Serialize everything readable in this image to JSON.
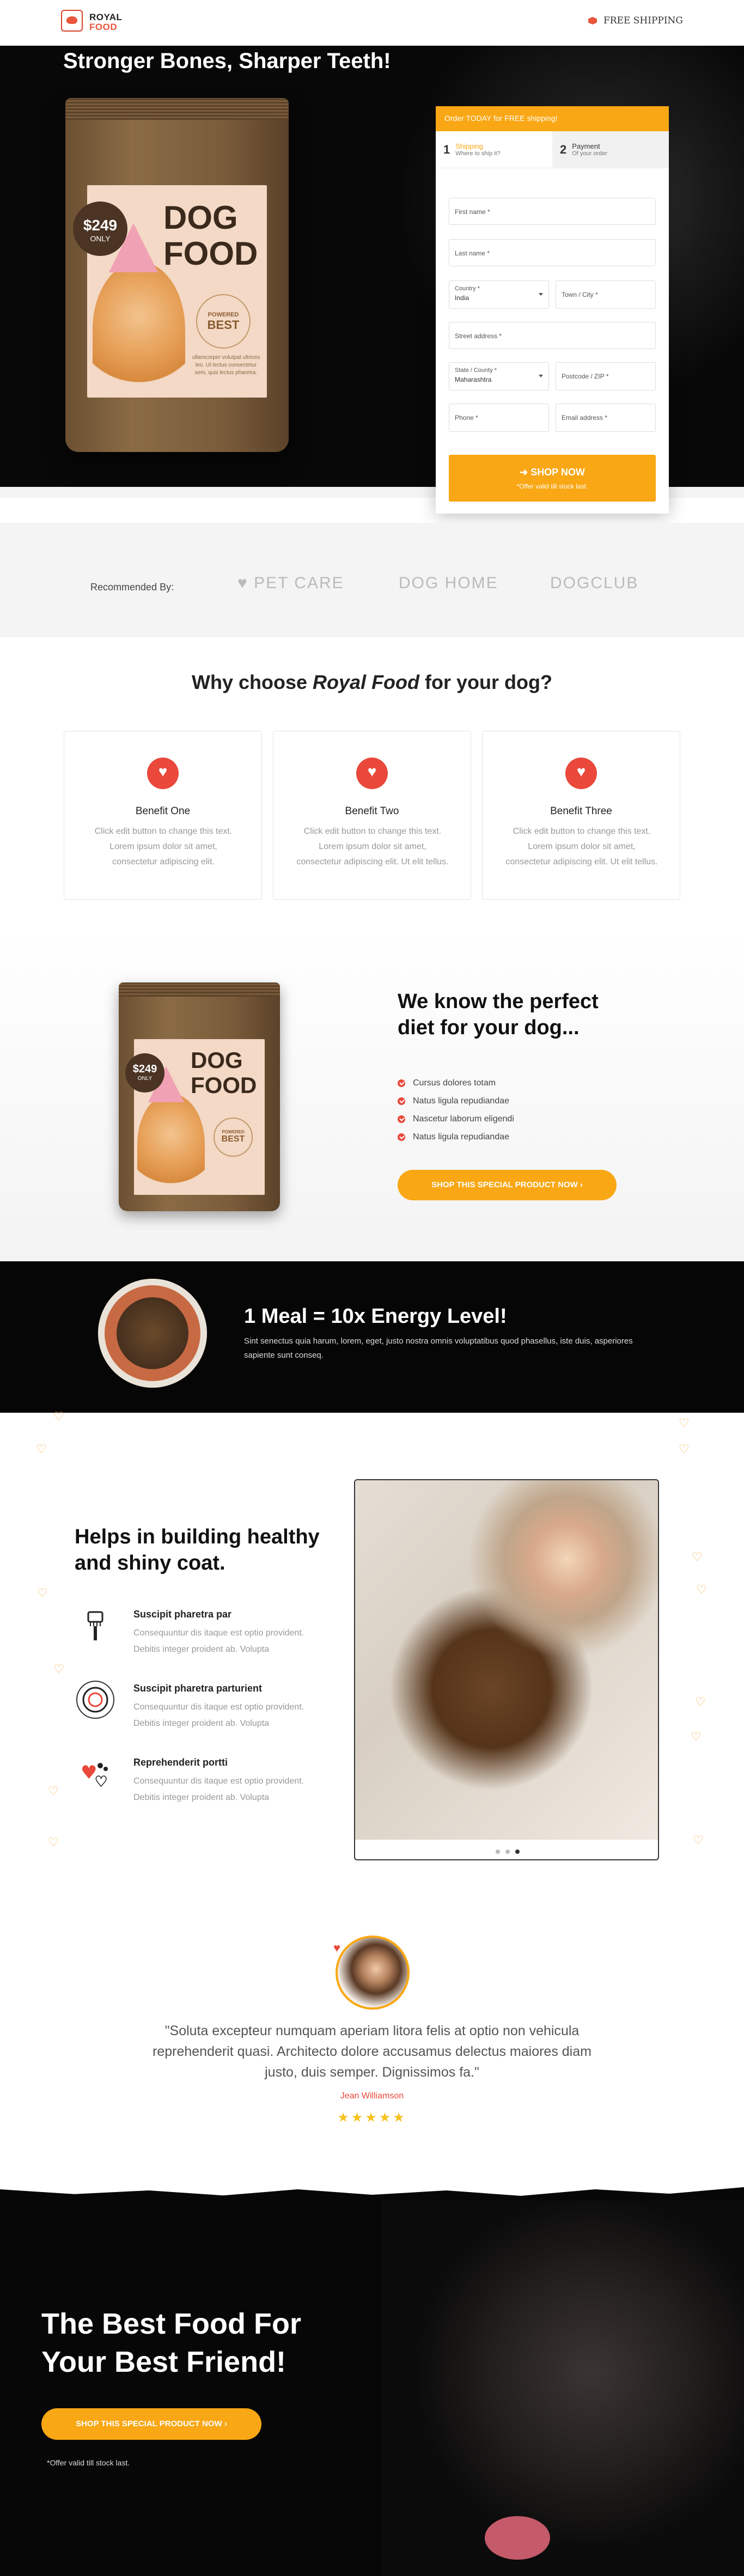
{
  "header": {
    "logo_line1": "ROYAL",
    "logo_line2": "FOOD",
    "shipping_label": "FREE SHIPPING"
  },
  "hero": {
    "title": "Stronger Bones, Sharper Teeth!",
    "product": {
      "brand_word1": "DOG",
      "brand_word2": "FOOD",
      "price": "$249",
      "price_note": "ONLY",
      "seal_line1": "POWERED",
      "seal_line2": "BEST",
      "blurb": "ullamcorper volutpat ultrices leo. Ut lectus consectetur sem, quis lectus pharetra."
    }
  },
  "form": {
    "banner": "Order TODAY for FREE shipping!",
    "steps": [
      {
        "num": "1",
        "title": "Shipping",
        "sub": "Where to ship it?"
      },
      {
        "num": "2",
        "title": "Payment",
        "sub": "Of your order"
      }
    ],
    "fields": {
      "first_name": "First name *",
      "last_name": "Last name *",
      "country_label": "Country *",
      "country_value": "India",
      "town": "Town / City *",
      "street": "Street address *",
      "state_label": "State / County *",
      "state_value": "Maharashtra",
      "postcode": "Postcode / ZIP *",
      "phone": "Phone *",
      "email": "Email address *"
    },
    "submit_label": "➜ SHOP NOW",
    "submit_note": "*Offer valid till stock last."
  },
  "recommended": {
    "label": "Recommended By:",
    "brands": [
      "PET CARE",
      "DOG HOME",
      "DOGCLUB"
    ]
  },
  "why": {
    "title_pre": "Why choose ",
    "title_em": "Royal Food",
    "title_post": " for your dog?",
    "cards": [
      {
        "title": "Benefit One",
        "desc": "Click edit button to change this text. Lorem ipsum dolor sit amet, consectetur adipiscing elit."
      },
      {
        "title": "Benefit Two",
        "desc": "Click edit button to change this text. Lorem ipsum dolor sit amet, consectetur adipiscing elit. Ut elit tellus."
      },
      {
        "title": "Benefit Three",
        "desc": "Click edit button to change this text. Lorem ipsum dolor sit amet, consectetur adipiscing elit. Ut elit tellus."
      }
    ]
  },
  "diet": {
    "title": "We know the perfect diet for your dog...",
    "checks": [
      "Cursus dolores totam",
      "Natus ligula repudiandae",
      "Nascetur laborum eligendi",
      "Natus ligula repudiandae"
    ],
    "cta": "SHOP THIS SPECIAL PRODUCT NOW ›"
  },
  "meal": {
    "title": "1 Meal = 10x Energy Level!",
    "desc": "Sint senectus quia harum, lorem, eget, justo nostra omnis voluptatibus quod phasellus, iste duis, asperiores sapiente sunt conseq."
  },
  "coat": {
    "title": "Helps in building healthy and shiny coat.",
    "features": [
      {
        "title": "Suscipit pharetra par",
        "desc": "Consequuntur dis itaque est optio provident. Debitis integer proident ab. Volupta"
      },
      {
        "title": "Suscipit pharetra parturient",
        "desc": "Consequuntur dis itaque est optio provident. Debitis integer proident ab. Volupta"
      },
      {
        "title": "Reprehenderit portti",
        "desc": "Consequuntur dis itaque est optio provident. Debitis integer proident ab. Volupta"
      }
    ]
  },
  "testimonial": {
    "quote": "\"Soluta excepteur numquam aperiam litora felis at optio non vehicula reprehenderit quasi. Architecto dolore accusamus delectus maiores diam justo, duis semper. Dignissimos fa.\"",
    "name": "Jean Williamson",
    "stars": "★★★★★",
    "rating": 5
  },
  "bottom": {
    "title": "The Best Food For Your Best Friend!",
    "cta": "SHOP THIS SPECIAL PRODUCT NOW ›",
    "note": "*Offer valid till stock last."
  },
  "colors": {
    "accent": "#f9a714",
    "brand_red": "#e9483a",
    "dark": "#070707"
  }
}
